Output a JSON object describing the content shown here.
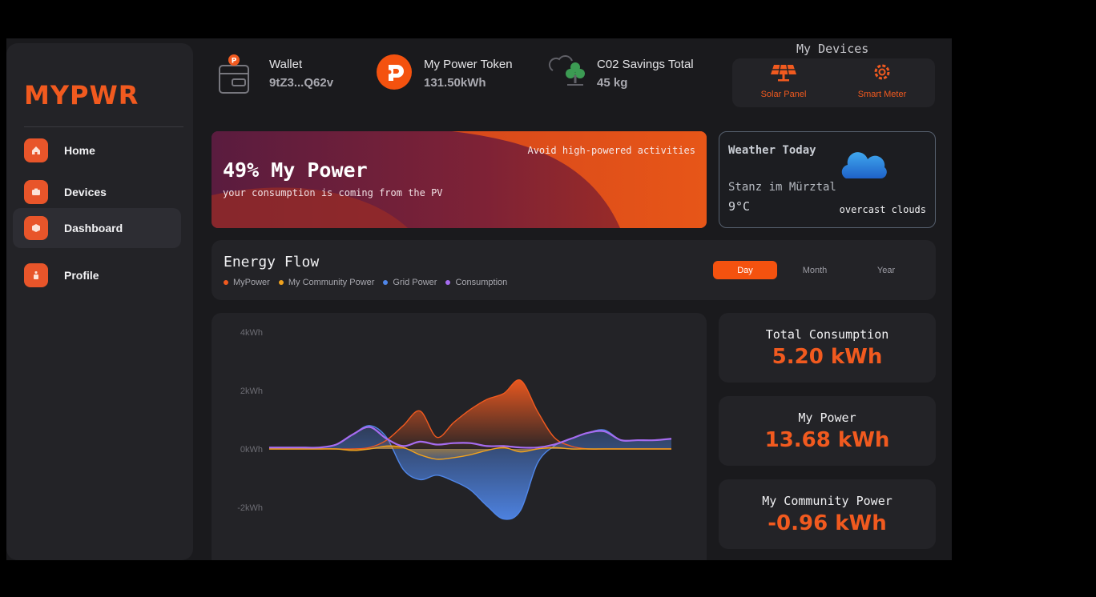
{
  "brand": {
    "logo": "MYPWR",
    "accent": "#f15a1f"
  },
  "sidebar": {
    "items": [
      {
        "label": "Home",
        "icon": "home-icon"
      },
      {
        "label": "Devices",
        "icon": "devices-icon"
      },
      {
        "label": "Dashboard",
        "icon": "dashboard-icon",
        "active": true
      },
      {
        "label": "Profile",
        "icon": "profile-icon"
      }
    ]
  },
  "topbar": {
    "wallet": {
      "label": "Wallet",
      "value": "9tZ3...Q62v",
      "icon": "wallet-icon"
    },
    "token": {
      "label": "My Power Token",
      "value": "131.50kWh",
      "icon": "power-token-icon"
    },
    "co2": {
      "label": "C02 Savings Total",
      "value": "45 kg",
      "icon": "co2-tree-icon"
    }
  },
  "devices": {
    "title": "My Devices",
    "items": [
      {
        "label": "Solar Panel",
        "icon": "solar-panel-icon"
      },
      {
        "label": "Smart Meter",
        "icon": "smart-meter-icon"
      }
    ]
  },
  "banner": {
    "note": "Avoid high-powered activities",
    "title": "49% My Power",
    "subtitle": "your consumption is coming from the PV"
  },
  "weather": {
    "title": "Weather Today",
    "location": "Stanz im Mürztal",
    "temperature": "9°C",
    "description": "overcast clouds",
    "icon": "cloud-icon"
  },
  "energy_flow": {
    "title": "Energy Flow",
    "legend": [
      {
        "label": "MyPower",
        "color": "#f15a1f"
      },
      {
        "label": "My Community Power",
        "color": "#f0a21e"
      },
      {
        "label": "Grid Power",
        "color": "#4f86e8"
      },
      {
        "label": "Consumption",
        "color": "#a66cf0"
      }
    ],
    "ranges": [
      "Day",
      "Month",
      "Year"
    ],
    "selected_range": "Day"
  },
  "chart_data": {
    "type": "area",
    "ylim": [
      -3,
      4
    ],
    "yticks": [
      "4kWh",
      "2kWh",
      "0kWh",
      "-2kWh"
    ],
    "ytick_values": [
      4,
      2,
      0,
      -2
    ],
    "x": [
      0,
      1,
      2,
      3,
      4,
      5,
      6,
      7,
      8,
      9,
      10,
      11,
      12,
      13,
      14,
      15,
      16,
      17,
      18,
      19,
      20,
      21,
      22,
      23,
      24
    ],
    "series": [
      {
        "name": "MyPower",
        "color": "#f15a1f",
        "values": [
          0,
          0,
          0,
          0,
          0,
          0,
          0.05,
          0.3,
          0.8,
          1.3,
          0.4,
          0.9,
          1.35,
          1.7,
          1.9,
          2.35,
          1.3,
          0.4,
          0.1,
          0,
          0,
          0,
          0,
          0,
          0
        ]
      },
      {
        "name": "My Community Power",
        "color": "#f0a21e",
        "values": [
          0,
          0,
          0,
          0,
          0,
          -0.05,
          0,
          0.1,
          0.05,
          -0.2,
          -0.35,
          -0.3,
          -0.2,
          -0.05,
          0.05,
          -0.1,
          0,
          0.05,
          0,
          0,
          0,
          0,
          0,
          0,
          0
        ]
      },
      {
        "name": "Grid Power",
        "color": "#4f86e8",
        "values": [
          0.05,
          0.05,
          0.05,
          0.05,
          0.15,
          0.5,
          0.8,
          0.4,
          -0.7,
          -1.05,
          -0.9,
          -1.1,
          -1.4,
          -1.95,
          -2.4,
          -2.1,
          -0.5,
          0.1,
          0.35,
          0.55,
          0.65,
          0.3,
          0.3,
          0.3,
          0.35
        ]
      },
      {
        "name": "Consumption",
        "color": "#a66cf0",
        "values": [
          0.05,
          0.05,
          0.05,
          0.05,
          0.15,
          0.5,
          0.75,
          0.35,
          0.1,
          0.25,
          0.15,
          0.2,
          0.2,
          0.1,
          0.1,
          0.05,
          0.05,
          0.15,
          0.35,
          0.55,
          0.6,
          0.3,
          0.3,
          0.3,
          0.35
        ]
      }
    ]
  },
  "stats": [
    {
      "label": "Total Consumption",
      "value": "5.20 kWh"
    },
    {
      "label": "My Power",
      "value": "13.68 kWh"
    },
    {
      "label": "My Community Power",
      "value": "-0.96 kWh"
    }
  ]
}
